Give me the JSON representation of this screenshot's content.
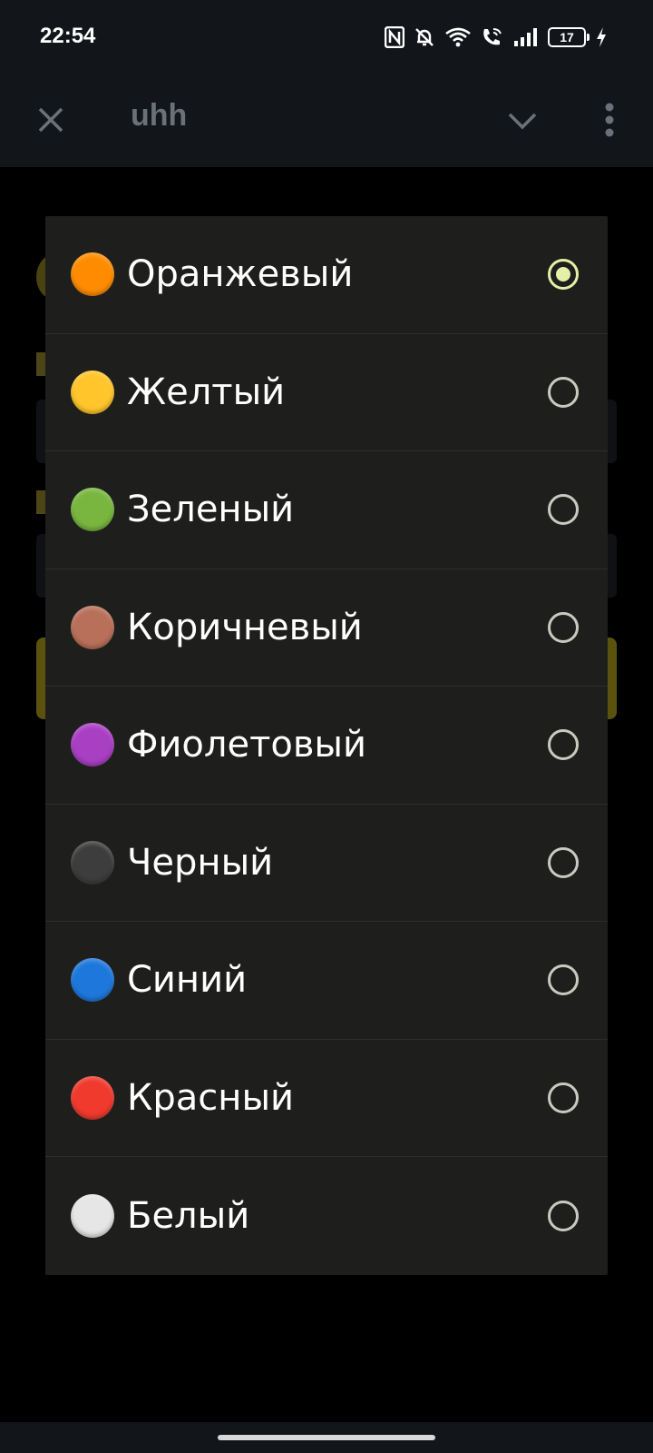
{
  "status_bar": {
    "time": "22:54",
    "battery": "17",
    "icons": [
      "nfc-icon",
      "bell-off-icon",
      "wifi-icon",
      "wifi-call-icon",
      "signal-icon",
      "battery-icon",
      "charging-icon"
    ]
  },
  "app_bar": {
    "title": "uhh",
    "icons": [
      "close-icon",
      "chevron-down-icon",
      "more-vert-icon"
    ]
  },
  "dialog": {
    "selected_index": 0,
    "options": [
      {
        "label": "Оранжевый",
        "color": "#ff8c00",
        "selected": true
      },
      {
        "label": "Желтый",
        "color": "#ffc52b",
        "selected": false
      },
      {
        "label": "Зеленый",
        "color": "#79b640",
        "selected": false
      },
      {
        "label": "Коричневый",
        "color": "#b9705a",
        "selected": false
      },
      {
        "label": "Фиолетовый",
        "color": "#a93fc3",
        "selected": false
      },
      {
        "label": "Черный",
        "color": "#3d3d3d",
        "selected": false
      },
      {
        "label": "Синий",
        "color": "#1e78dc",
        "selected": false
      },
      {
        "label": "Красный",
        "color": "#f03a2e",
        "selected": false
      },
      {
        "label": "Белый",
        "color": "#e6e6e6",
        "selected": false
      }
    ]
  },
  "colors": {
    "radio_selected": "#e3f0a8",
    "radio_unselected": "#c9cabf",
    "dialog_bg": "#1e1f1c",
    "bar_bg": "#12161b"
  }
}
